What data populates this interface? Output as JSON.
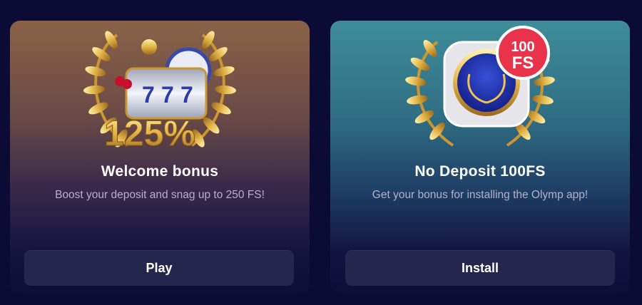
{
  "cards": [
    {
      "title": "Welcome bonus",
      "description": "Boost your deposit and snag up to 250 FS!",
      "button_label": "Play",
      "badge": "125%",
      "slot_symbols": [
        "7",
        "7",
        "7"
      ],
      "accent": "#f2c14a"
    },
    {
      "title": "No Deposit 100FS",
      "description": "Get your bonus for installing the Olymp app!",
      "button_label": "Install",
      "badge_line1": "100",
      "badge_line2": "FS",
      "accent": "#e8334a"
    }
  ],
  "colors": {
    "page_background": "#0c0b36",
    "button_background": "#26264c",
    "laurel_gold": "#d4a53a"
  },
  "icons": [
    "laurel-wreath-icon",
    "slot-machine-icon",
    "olymp-app-icon"
  ]
}
